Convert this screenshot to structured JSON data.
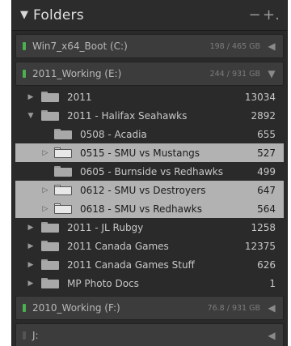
{
  "panel": {
    "title": "Folders",
    "collapse_icon": "triangle-down-icon",
    "remove_label": "−",
    "add_label": "+."
  },
  "volumes": [
    {
      "name": "Win7_x64_Boot (C:)",
      "size": "198 / 465 GB",
      "led_color": "#4caf50",
      "expanded": false
    },
    {
      "name": "2011_Working (E:)",
      "size": "244 / 931 GB",
      "led_color": "#4caf50",
      "expanded": true
    },
    {
      "name": "2010_Working (F:)",
      "size": "76.8 / 931 GB",
      "led_color": "#4caf50",
      "expanded": false
    },
    {
      "name": "J:",
      "size": "",
      "led_color": "#555555",
      "expanded": false
    }
  ],
  "folders": [
    {
      "name": "2011",
      "count": "13034",
      "level": 0,
      "expanded": false,
      "selected": false
    },
    {
      "name": "2011 - Halifax Seahawks",
      "count": "2892",
      "level": 0,
      "expanded": true,
      "selected": false
    },
    {
      "name": "0508 - Acadia",
      "count": "655",
      "level": 1,
      "expanded": false,
      "selected": false
    },
    {
      "name": "0515 - SMU vs Mustangs",
      "count": "527",
      "level": 1,
      "expanded": false,
      "selected": true
    },
    {
      "name": "0605 - Burnside vs Redhawks",
      "count": "499",
      "level": 1,
      "expanded": false,
      "selected": false
    },
    {
      "name": "0612 - SMU vs Destroyers",
      "count": "647",
      "level": 1,
      "expanded": false,
      "selected": true
    },
    {
      "name": "0618 - SMU vs Redhawks",
      "count": "564",
      "level": 1,
      "expanded": false,
      "selected": true
    },
    {
      "name": "2011 - JL Rubgy",
      "count": "1258",
      "level": 0,
      "expanded": false,
      "selected": false
    },
    {
      "name": "2011 Canada Games",
      "count": "12375",
      "level": 0,
      "expanded": false,
      "selected": false
    },
    {
      "name": "2011 Canada Games Stuff",
      "count": "626",
      "level": 0,
      "expanded": false,
      "selected": false
    },
    {
      "name": "MP Photo Docs",
      "count": "1",
      "level": 0,
      "expanded": false,
      "selected": false
    }
  ]
}
